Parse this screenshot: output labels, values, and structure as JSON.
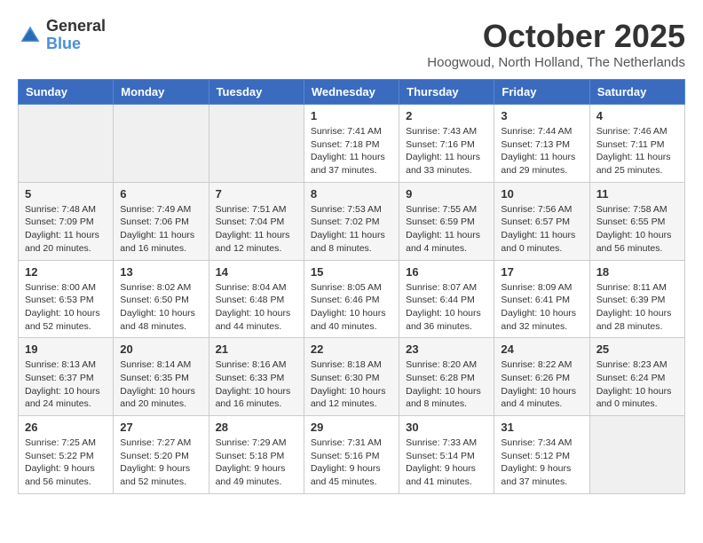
{
  "logo": {
    "line1": "General",
    "line2": "Blue"
  },
  "title": "October 2025",
  "subtitle": "Hoogwoud, North Holland, The Netherlands",
  "weekdays": [
    "Sunday",
    "Monday",
    "Tuesday",
    "Wednesday",
    "Thursday",
    "Friday",
    "Saturday"
  ],
  "weeks": [
    [
      {
        "day": "",
        "info": ""
      },
      {
        "day": "",
        "info": ""
      },
      {
        "day": "",
        "info": ""
      },
      {
        "day": "1",
        "info": "Sunrise: 7:41 AM\nSunset: 7:18 PM\nDaylight: 11 hours\nand 37 minutes."
      },
      {
        "day": "2",
        "info": "Sunrise: 7:43 AM\nSunset: 7:16 PM\nDaylight: 11 hours\nand 33 minutes."
      },
      {
        "day": "3",
        "info": "Sunrise: 7:44 AM\nSunset: 7:13 PM\nDaylight: 11 hours\nand 29 minutes."
      },
      {
        "day": "4",
        "info": "Sunrise: 7:46 AM\nSunset: 7:11 PM\nDaylight: 11 hours\nand 25 minutes."
      }
    ],
    [
      {
        "day": "5",
        "info": "Sunrise: 7:48 AM\nSunset: 7:09 PM\nDaylight: 11 hours\nand 20 minutes."
      },
      {
        "day": "6",
        "info": "Sunrise: 7:49 AM\nSunset: 7:06 PM\nDaylight: 11 hours\nand 16 minutes."
      },
      {
        "day": "7",
        "info": "Sunrise: 7:51 AM\nSunset: 7:04 PM\nDaylight: 11 hours\nand 12 minutes."
      },
      {
        "day": "8",
        "info": "Sunrise: 7:53 AM\nSunset: 7:02 PM\nDaylight: 11 hours\nand 8 minutes."
      },
      {
        "day": "9",
        "info": "Sunrise: 7:55 AM\nSunset: 6:59 PM\nDaylight: 11 hours\nand 4 minutes."
      },
      {
        "day": "10",
        "info": "Sunrise: 7:56 AM\nSunset: 6:57 PM\nDaylight: 11 hours\nand 0 minutes."
      },
      {
        "day": "11",
        "info": "Sunrise: 7:58 AM\nSunset: 6:55 PM\nDaylight: 10 hours\nand 56 minutes."
      }
    ],
    [
      {
        "day": "12",
        "info": "Sunrise: 8:00 AM\nSunset: 6:53 PM\nDaylight: 10 hours\nand 52 minutes."
      },
      {
        "day": "13",
        "info": "Sunrise: 8:02 AM\nSunset: 6:50 PM\nDaylight: 10 hours\nand 48 minutes."
      },
      {
        "day": "14",
        "info": "Sunrise: 8:04 AM\nSunset: 6:48 PM\nDaylight: 10 hours\nand 44 minutes."
      },
      {
        "day": "15",
        "info": "Sunrise: 8:05 AM\nSunset: 6:46 PM\nDaylight: 10 hours\nand 40 minutes."
      },
      {
        "day": "16",
        "info": "Sunrise: 8:07 AM\nSunset: 6:44 PM\nDaylight: 10 hours\nand 36 minutes."
      },
      {
        "day": "17",
        "info": "Sunrise: 8:09 AM\nSunset: 6:41 PM\nDaylight: 10 hours\nand 32 minutes."
      },
      {
        "day": "18",
        "info": "Sunrise: 8:11 AM\nSunset: 6:39 PM\nDaylight: 10 hours\nand 28 minutes."
      }
    ],
    [
      {
        "day": "19",
        "info": "Sunrise: 8:13 AM\nSunset: 6:37 PM\nDaylight: 10 hours\nand 24 minutes."
      },
      {
        "day": "20",
        "info": "Sunrise: 8:14 AM\nSunset: 6:35 PM\nDaylight: 10 hours\nand 20 minutes."
      },
      {
        "day": "21",
        "info": "Sunrise: 8:16 AM\nSunset: 6:33 PM\nDaylight: 10 hours\nand 16 minutes."
      },
      {
        "day": "22",
        "info": "Sunrise: 8:18 AM\nSunset: 6:30 PM\nDaylight: 10 hours\nand 12 minutes."
      },
      {
        "day": "23",
        "info": "Sunrise: 8:20 AM\nSunset: 6:28 PM\nDaylight: 10 hours\nand 8 minutes."
      },
      {
        "day": "24",
        "info": "Sunrise: 8:22 AM\nSunset: 6:26 PM\nDaylight: 10 hours\nand 4 minutes."
      },
      {
        "day": "25",
        "info": "Sunrise: 8:23 AM\nSunset: 6:24 PM\nDaylight: 10 hours\nand 0 minutes."
      }
    ],
    [
      {
        "day": "26",
        "info": "Sunrise: 7:25 AM\nSunset: 5:22 PM\nDaylight: 9 hours\nand 56 minutes."
      },
      {
        "day": "27",
        "info": "Sunrise: 7:27 AM\nSunset: 5:20 PM\nDaylight: 9 hours\nand 52 minutes."
      },
      {
        "day": "28",
        "info": "Sunrise: 7:29 AM\nSunset: 5:18 PM\nDaylight: 9 hours\nand 49 minutes."
      },
      {
        "day": "29",
        "info": "Sunrise: 7:31 AM\nSunset: 5:16 PM\nDaylight: 9 hours\nand 45 minutes."
      },
      {
        "day": "30",
        "info": "Sunrise: 7:33 AM\nSunset: 5:14 PM\nDaylight: 9 hours\nand 41 minutes."
      },
      {
        "day": "31",
        "info": "Sunrise: 7:34 AM\nSunset: 5:12 PM\nDaylight: 9 hours\nand 37 minutes."
      },
      {
        "day": "",
        "info": ""
      }
    ]
  ]
}
